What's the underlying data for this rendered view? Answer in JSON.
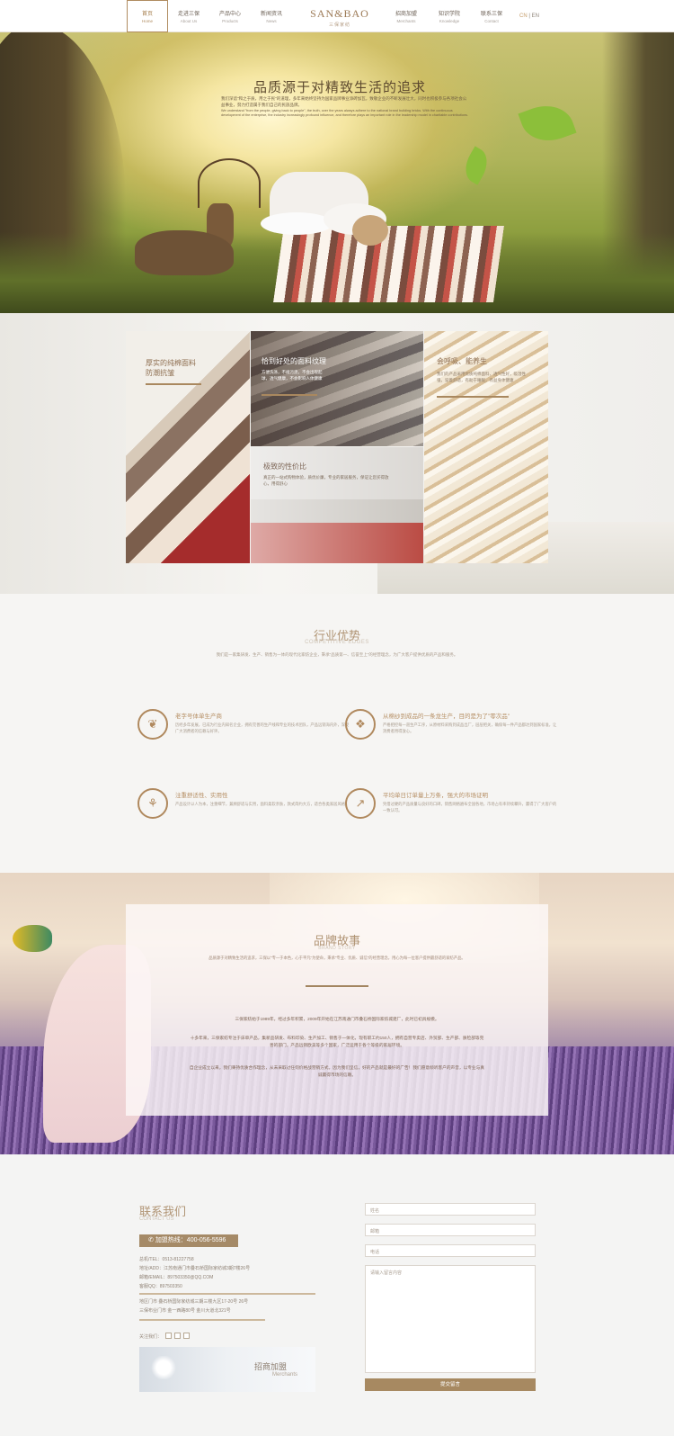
{
  "nav": {
    "items": [
      {
        "cn": "首页",
        "en": "Home"
      },
      {
        "cn": "走进三保",
        "en": "About Us"
      },
      {
        "cn": "产品中心",
        "en": "Products"
      },
      {
        "cn": "新闻资讯",
        "en": "News"
      },
      {
        "cn": "招商加盟",
        "en": "Merchants"
      },
      {
        "cn": "知识学院",
        "en": "Knowledge"
      },
      {
        "cn": "联系三保",
        "en": "Contact"
      }
    ],
    "logo": "SAN&BAO",
    "logo_sub": "三保家纺",
    "lang_cn": "CN",
    "lang_sep": " | ",
    "lang_en": "EN"
  },
  "hero": {
    "title": "品质源于对精致生活的追求",
    "desc_cn": "我们深谙\"和之于质，用之于民\"的道理，多年来始终坚持为国家品牌事业添砖加瓦，致敬企业的不断发展壮大，同时也积极参与各项社会公益事业，努力打造属于我们自己的民族品牌。",
    "desc_en": "We understand \"from the people, giving back to people\", the truth, over the years always adhere to the national brand building bricks. With the continuous development of the enterprise, the industry increasingly profound influence, and therefore plays an important role in the leadership model in charitable contributions."
  },
  "features": [
    {
      "title": "厚实的纯棉面料\n防潮抗皱",
      "desc": ""
    },
    {
      "title": "恰到好处的面料纹理",
      "desc": "方便洗涤，不褪污渍，不会出现起球，透气健康，不会影响人体健康"
    },
    {
      "title": "极致的性价比",
      "desc": "真正的一站式购物体验，质优价廉，专业的家居服务，保证让您买得放心，用得舒心"
    },
    {
      "title": "会呼吸、能养生",
      "desc": "我们的产品采用优质纯棉面料，透气性好，吸湿性强，穿着舒适，有助于睡眠，有益身体健康"
    }
  ],
  "advantages": {
    "title": "行业优势",
    "subtitle": "COMPETITIVE EDGES",
    "desc": "我们是一家集研发、生产、销售为一体的现代化家纺企业，秉承\"品质第一、信誉至上\"的经营理念，为广大客户提供优质的产品和服务。",
    "items": [
      {
        "icon": "leaf-icon",
        "title": "老字号体单生产商",
        "desc": "历经多年发展，已成为行业内知名企业，拥有完善的生产线和专业的技术团队，产品远销海内外，深受广大消费者的信赖与好评。"
      },
      {
        "icon": "box-icon",
        "title": "从棉纱到成品的一条龙生产，目的是为了\"零次品\"",
        "desc": "严格把控每一道生产工序，从原材料采购到成品出厂，层层把关，确保每一件产品都达到国家标准，让消费者用得放心。"
      },
      {
        "icon": "sprout-icon",
        "title": "注重舒适性、实用性",
        "desc": "产品设计以人为本，注重细节，兼顾舒适与实用，面料柔软亲肤，款式简约大方，适合各类家居风格。"
      },
      {
        "icon": "arrow-icon",
        "title": "平均单日订单量上万条，强大的市场证明",
        "desc": "凭借过硬的产品质量与良好的口碑，销售网络遍布全国各地，市场占有率持续攀升，赢得了广大客户的一致认可。"
      }
    ]
  },
  "story": {
    "title": "品牌故事",
    "subtitle": "BRAND STORY",
    "intro": "品质源于对精致生活的追求，三保以\"专一于本色，心于平凡\"为使命，秉承\"专业、优质、诚信\"的经营理念，用心为每一位客户提供最舒适的家纺产品。",
    "p1": "三保家纺始于1989年，经过多年积累，2009年开始在江苏南通门市叠石桥国际家纺城建厂，此时已初具规模。",
    "p2": "十多年来，三保家纺专注于床单产品，集新品研发、布料印染、生产加工、销售于一体化，现有职工约150人，拥有自营专卖店、外贸部、生产部、质检部等完善的部门，产品远销欧美等多个国家，广泛运用于各个等级的家居环境。",
    "p3": "自企业成立以来，我们秉持优质合作理念，从未采取过任何价格战营销方式，因为我们坚信，好的产品就是最好的广告！我们愿意倾听客户的声音，以专业与真诚赢得市场的信赖。"
  },
  "contact": {
    "title": "联系我们",
    "subtitle": "CONTACT US",
    "hotline": "加盟热线：400-056-5596",
    "tel": "总机/TEL：0513-81227758",
    "addr": "地址/ADD：江苏南通门市叠石桥国际家纺城3期7楼26号",
    "email": "邮箱/EMAIL：897503350@QQ.COM",
    "qq": "客服QQ：897503350",
    "store1": "地区门市 叠石桥国际家纺城三期三楼九区17-20号 26号",
    "store2": "三保布业门市 金一西路80号 金川大道北321号",
    "follow": "关注我们：",
    "banner_title": "招商加盟",
    "banner_sub": "Merchants",
    "form": {
      "name": "姓名",
      "phone": "邮箱",
      "tel": "电话",
      "message": "请输入留言内容",
      "submit": "提交留言"
    }
  }
}
